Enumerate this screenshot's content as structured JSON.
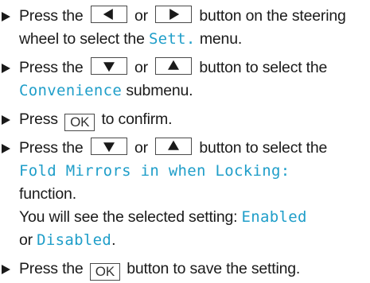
{
  "steps": [
    {
      "t1": "Press the",
      "t2": "or",
      "t3": "button on the steering wheel to select the",
      "menu": "Sett.",
      "t4": "menu.",
      "keys": [
        "left-arrow-key",
        "right-arrow-key"
      ]
    },
    {
      "t1": "Press the",
      "t2": "or",
      "t3": "button to select the",
      "submenu": "Convenience",
      "t4": "submenu.",
      "keys": [
        "down-arrow-key",
        "up-arrow-key"
      ]
    },
    {
      "t1": "Press",
      "ok": "OK",
      "t2": "to confirm."
    },
    {
      "t1": "Press the",
      "t2": "or",
      "t3": "button to select the",
      "function": "Fold Mirrors in when Locking:",
      "t4": "function.",
      "t5": "You will see the selected setting:",
      "enabled": "Enabled",
      "or": "or",
      "disabled": "Disabled",
      "period": ".",
      "keys": [
        "down-arrow-key",
        "up-arrow-key"
      ]
    },
    {
      "t1": "Press the",
      "ok": "OK",
      "t2": "button to save the setting."
    }
  ],
  "colors": {
    "highlight": "#1f9ec9",
    "text": "#1a1a1a"
  }
}
